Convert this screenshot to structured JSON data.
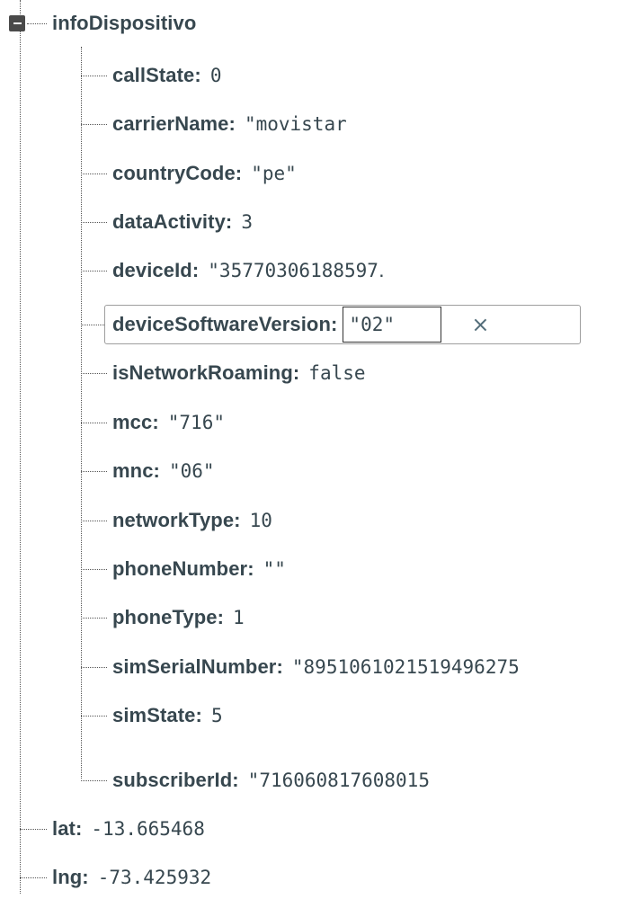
{
  "node": {
    "key": "infoDispositivo",
    "collapse_icon": "minus-box-icon",
    "children": [
      {
        "key": "callState:",
        "value": "0"
      },
      {
        "key": "carrierName:",
        "value": "\"movistar"
      },
      {
        "key": "countryCode:",
        "value": "\"pe\""
      },
      {
        "key": "dataActivity:",
        "value": "3"
      },
      {
        "key": "deviceId:",
        "value": "\"35770306188597․"
      }
    ],
    "editing": {
      "key": "deviceSoftwareVersion:",
      "value": "\"02\"",
      "close_icon": "close-icon",
      "close_label": "×"
    },
    "children_after": [
      {
        "key": "isNetworkRoaming:",
        "value": "false"
      },
      {
        "key": "mcc:",
        "value": "\"716\""
      },
      {
        "key": "mnc:",
        "value": "\"06\""
      },
      {
        "key": "networkType:",
        "value": "10"
      },
      {
        "key": "phoneNumber:",
        "value": "\"\""
      },
      {
        "key": "phoneType:",
        "value": "1"
      },
      {
        "key": "simSerialNumber:",
        "value": "\"8951061021519496275"
      },
      {
        "key": "simState:",
        "value": "5"
      },
      {
        "key": "subscriberId:",
        "value": "\"716060817608015"
      }
    ]
  },
  "siblings": [
    {
      "key": "lat:",
      "value": "-13.665468"
    },
    {
      "key": "lng:",
      "value": "-73.425932"
    }
  ]
}
